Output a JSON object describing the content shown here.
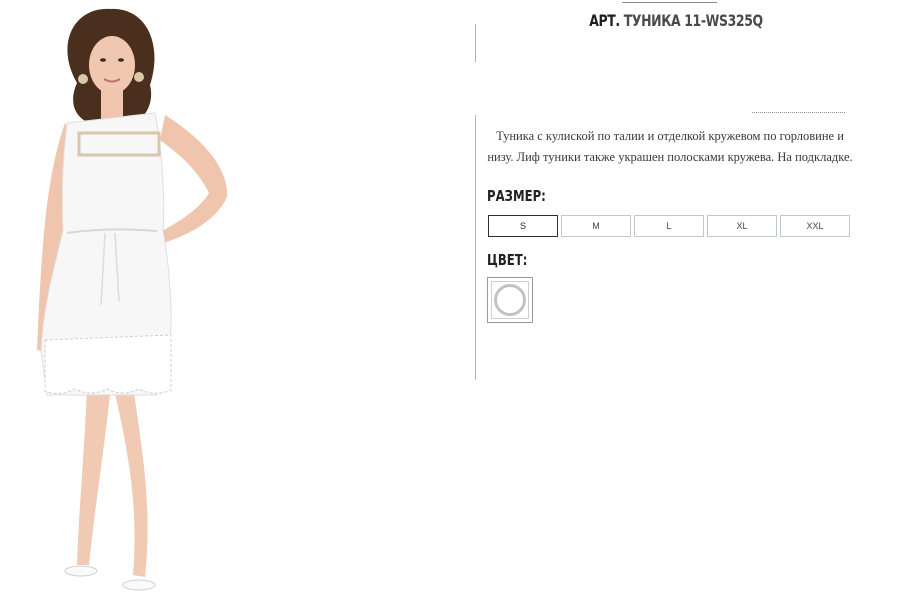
{
  "product": {
    "sku_prefix": "АРТ.",
    "sku_name": "ТУНИКА 11-WS325Q",
    "description": "Туника с кулиской по талии и отделкой кружевом по горловине и низу. Лиф туники также украшен полосками кружева. На подкладке.",
    "image_icon": "product-photo"
  },
  "size_section": {
    "label": "РАЗМЕР:",
    "options": [
      "S",
      "M",
      "L",
      "XL",
      "XXL"
    ],
    "selected": "S"
  },
  "color_section": {
    "label": "ЦВЕТ:",
    "swatch_color": "#ffffff"
  }
}
